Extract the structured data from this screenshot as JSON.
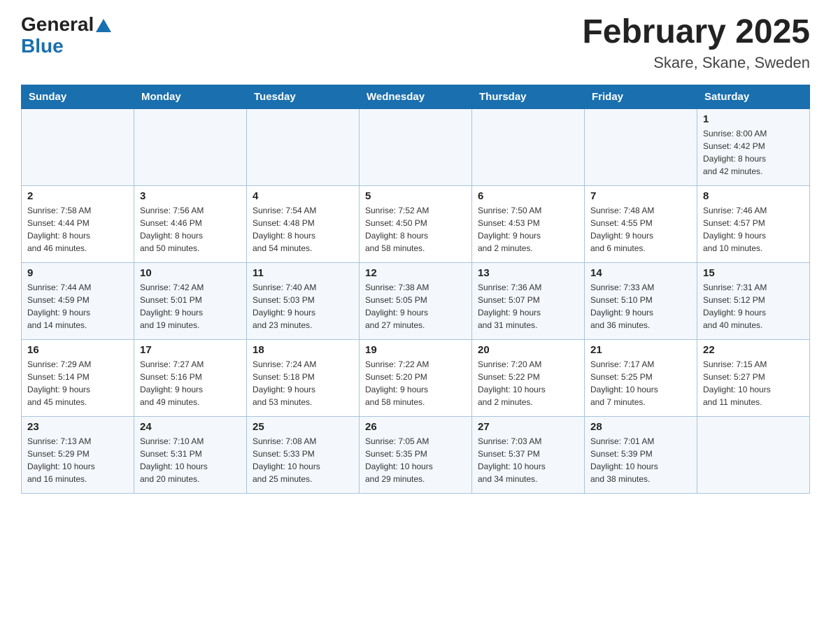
{
  "header": {
    "logo_general": "General",
    "logo_blue": "Blue",
    "month_title": "February 2025",
    "location": "Skare, Skane, Sweden"
  },
  "days_of_week": [
    "Sunday",
    "Monday",
    "Tuesday",
    "Wednesday",
    "Thursday",
    "Friday",
    "Saturday"
  ],
  "weeks": [
    [
      {
        "day": "",
        "info": ""
      },
      {
        "day": "",
        "info": ""
      },
      {
        "day": "",
        "info": ""
      },
      {
        "day": "",
        "info": ""
      },
      {
        "day": "",
        "info": ""
      },
      {
        "day": "",
        "info": ""
      },
      {
        "day": "1",
        "info": "Sunrise: 8:00 AM\nSunset: 4:42 PM\nDaylight: 8 hours\nand 42 minutes."
      }
    ],
    [
      {
        "day": "2",
        "info": "Sunrise: 7:58 AM\nSunset: 4:44 PM\nDaylight: 8 hours\nand 46 minutes."
      },
      {
        "day": "3",
        "info": "Sunrise: 7:56 AM\nSunset: 4:46 PM\nDaylight: 8 hours\nand 50 minutes."
      },
      {
        "day": "4",
        "info": "Sunrise: 7:54 AM\nSunset: 4:48 PM\nDaylight: 8 hours\nand 54 minutes."
      },
      {
        "day": "5",
        "info": "Sunrise: 7:52 AM\nSunset: 4:50 PM\nDaylight: 8 hours\nand 58 minutes."
      },
      {
        "day": "6",
        "info": "Sunrise: 7:50 AM\nSunset: 4:53 PM\nDaylight: 9 hours\nand 2 minutes."
      },
      {
        "day": "7",
        "info": "Sunrise: 7:48 AM\nSunset: 4:55 PM\nDaylight: 9 hours\nand 6 minutes."
      },
      {
        "day": "8",
        "info": "Sunrise: 7:46 AM\nSunset: 4:57 PM\nDaylight: 9 hours\nand 10 minutes."
      }
    ],
    [
      {
        "day": "9",
        "info": "Sunrise: 7:44 AM\nSunset: 4:59 PM\nDaylight: 9 hours\nand 14 minutes."
      },
      {
        "day": "10",
        "info": "Sunrise: 7:42 AM\nSunset: 5:01 PM\nDaylight: 9 hours\nand 19 minutes."
      },
      {
        "day": "11",
        "info": "Sunrise: 7:40 AM\nSunset: 5:03 PM\nDaylight: 9 hours\nand 23 minutes."
      },
      {
        "day": "12",
        "info": "Sunrise: 7:38 AM\nSunset: 5:05 PM\nDaylight: 9 hours\nand 27 minutes."
      },
      {
        "day": "13",
        "info": "Sunrise: 7:36 AM\nSunset: 5:07 PM\nDaylight: 9 hours\nand 31 minutes."
      },
      {
        "day": "14",
        "info": "Sunrise: 7:33 AM\nSunset: 5:10 PM\nDaylight: 9 hours\nand 36 minutes."
      },
      {
        "day": "15",
        "info": "Sunrise: 7:31 AM\nSunset: 5:12 PM\nDaylight: 9 hours\nand 40 minutes."
      }
    ],
    [
      {
        "day": "16",
        "info": "Sunrise: 7:29 AM\nSunset: 5:14 PM\nDaylight: 9 hours\nand 45 minutes."
      },
      {
        "day": "17",
        "info": "Sunrise: 7:27 AM\nSunset: 5:16 PM\nDaylight: 9 hours\nand 49 minutes."
      },
      {
        "day": "18",
        "info": "Sunrise: 7:24 AM\nSunset: 5:18 PM\nDaylight: 9 hours\nand 53 minutes."
      },
      {
        "day": "19",
        "info": "Sunrise: 7:22 AM\nSunset: 5:20 PM\nDaylight: 9 hours\nand 58 minutes."
      },
      {
        "day": "20",
        "info": "Sunrise: 7:20 AM\nSunset: 5:22 PM\nDaylight: 10 hours\nand 2 minutes."
      },
      {
        "day": "21",
        "info": "Sunrise: 7:17 AM\nSunset: 5:25 PM\nDaylight: 10 hours\nand 7 minutes."
      },
      {
        "day": "22",
        "info": "Sunrise: 7:15 AM\nSunset: 5:27 PM\nDaylight: 10 hours\nand 11 minutes."
      }
    ],
    [
      {
        "day": "23",
        "info": "Sunrise: 7:13 AM\nSunset: 5:29 PM\nDaylight: 10 hours\nand 16 minutes."
      },
      {
        "day": "24",
        "info": "Sunrise: 7:10 AM\nSunset: 5:31 PM\nDaylight: 10 hours\nand 20 minutes."
      },
      {
        "day": "25",
        "info": "Sunrise: 7:08 AM\nSunset: 5:33 PM\nDaylight: 10 hours\nand 25 minutes."
      },
      {
        "day": "26",
        "info": "Sunrise: 7:05 AM\nSunset: 5:35 PM\nDaylight: 10 hours\nand 29 minutes."
      },
      {
        "day": "27",
        "info": "Sunrise: 7:03 AM\nSunset: 5:37 PM\nDaylight: 10 hours\nand 34 minutes."
      },
      {
        "day": "28",
        "info": "Sunrise: 7:01 AM\nSunset: 5:39 PM\nDaylight: 10 hours\nand 38 minutes."
      },
      {
        "day": "",
        "info": ""
      }
    ]
  ]
}
